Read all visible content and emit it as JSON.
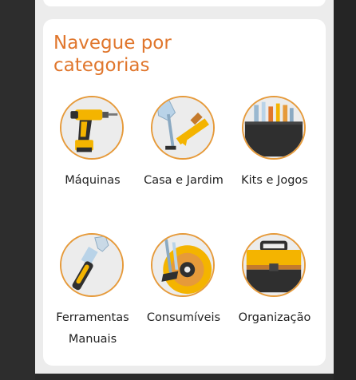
{
  "section": {
    "title": "Navegue por categorias",
    "categories": [
      {
        "label": "Máquinas",
        "icon": "drill-icon"
      },
      {
        "label": "Casa e Jardim",
        "icon": "garden-tools-icon"
      },
      {
        "label": "Kits e Jogos",
        "icon": "tool-kit-icon"
      },
      {
        "label": "Ferramentas Manuais",
        "icon": "wrench-icon"
      },
      {
        "label": "Consumíveis",
        "icon": "cutting-disc-icon"
      },
      {
        "label": "Organização",
        "icon": "toolbox-icon"
      }
    ]
  },
  "colors": {
    "accent": "#e0762c",
    "circle_border": "#e69a3a",
    "tool_yellow": "#f4b400",
    "tool_dark": "#2f2f2f"
  }
}
